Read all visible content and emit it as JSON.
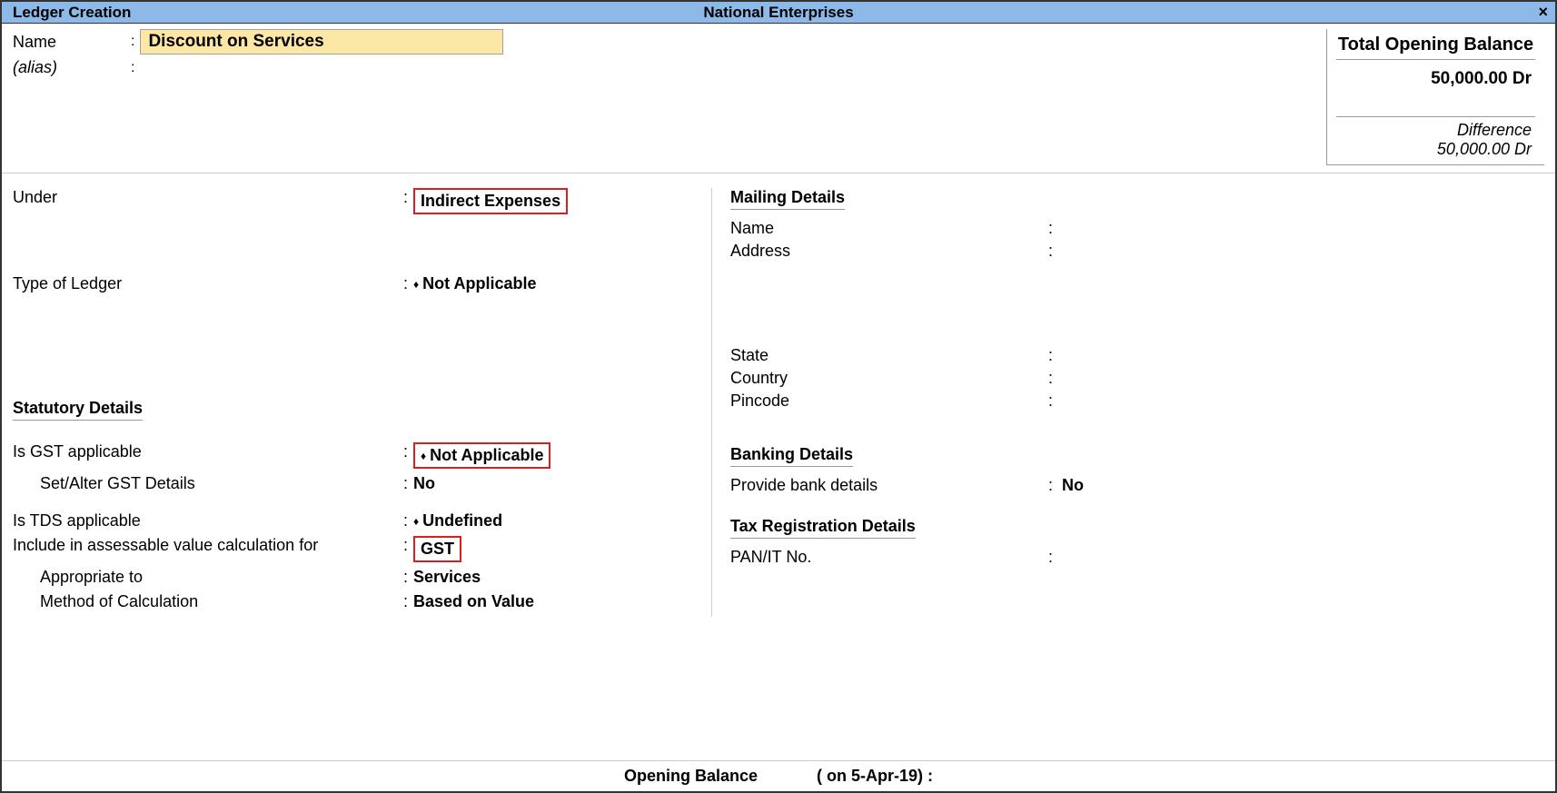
{
  "titlebar": {
    "left": "Ledger Creation",
    "center": "National Enterprises"
  },
  "name_section": {
    "name_label": "Name",
    "name_value": "Discount on Services",
    "alias_label": "(alias)"
  },
  "balance_panel": {
    "title": "Total Opening Balance",
    "amount": "50,000.00 Dr",
    "diff_label": "Difference",
    "diff_amount": "50,000.00 Dr"
  },
  "left": {
    "under_label": "Under",
    "under_value": "Indirect Expenses",
    "type_label": "Type of Ledger",
    "type_value": "Not Applicable",
    "stat_header": "Statutory Details",
    "gst_label": "Is GST applicable",
    "gst_value": "Not Applicable",
    "setalter_label": "Set/Alter GST Details",
    "setalter_value": "No",
    "tds_label": "Is TDS applicable",
    "tds_value": "Undefined",
    "include_label": "Include in assessable value calculation for",
    "include_value": "GST",
    "appropriate_label": "Appropriate to",
    "appropriate_value": "Services",
    "method_label": "Method of Calculation",
    "method_value": "Based on Value"
  },
  "right": {
    "mailing_header": "Mailing Details",
    "mail_name_label": "Name",
    "mail_addr_label": "Address",
    "state_label": "State",
    "country_label": "Country",
    "pincode_label": "Pincode",
    "banking_header": "Banking Details",
    "bank_label": "Provide bank details",
    "bank_value": "No",
    "tax_header": "Tax Registration Details",
    "pan_label": "PAN/IT No."
  },
  "bottom": {
    "label": "Opening Balance",
    "date": "( on 5-Apr-19)  :"
  }
}
